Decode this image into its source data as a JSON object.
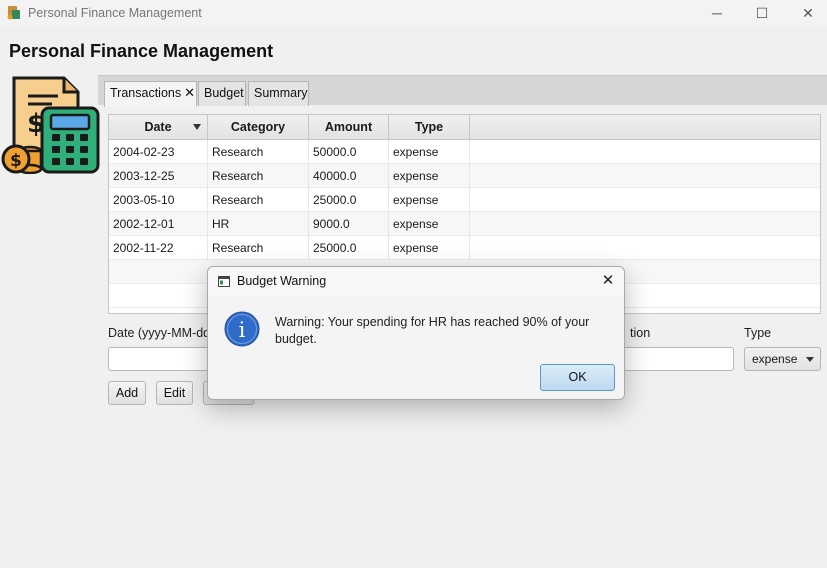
{
  "window": {
    "title": "Personal Finance Management",
    "minimize_glyph": "─",
    "maximize_glyph": "☐",
    "close_glyph": "✕"
  },
  "app": {
    "heading": "Personal Finance Management",
    "logo_icon": "finance-calculator-icon"
  },
  "tabs": [
    {
      "label": "Transactions",
      "active": true,
      "closable": true
    },
    {
      "label": "Budget",
      "active": false
    },
    {
      "label": "Summary",
      "active": false
    }
  ],
  "table": {
    "columns": [
      "Date",
      "Category",
      "Amount",
      "Type"
    ],
    "sort_column": "Date",
    "rows": [
      [
        "2004-02-23",
        "Research",
        "50000.0",
        "expense"
      ],
      [
        "2003-12-25",
        "Research",
        "40000.0",
        "expense"
      ],
      [
        "2003-05-10",
        "Research",
        "25000.0",
        "expense"
      ],
      [
        "2002-12-01",
        "HR",
        "9000.0",
        "expense"
      ],
      [
        "2002-11-22",
        "Research",
        "25000.0",
        "expense"
      ]
    ]
  },
  "form": {
    "date_label": "Date (yyyy-MM-dd",
    "description_label_partial": "tion",
    "type_label": "Type",
    "type_value": "expense",
    "add_button": "Add",
    "edit_button": "Edit"
  },
  "dialog": {
    "title": "Budget Warning",
    "message": "Warning: Your spending for HR has reached 90% of your budget.",
    "ok_button": "OK",
    "close_glyph": "✕",
    "icon": "info-icon"
  },
  "colors": {
    "info_blue": "#2f6bc9",
    "ok_border": "#5e98c7"
  }
}
